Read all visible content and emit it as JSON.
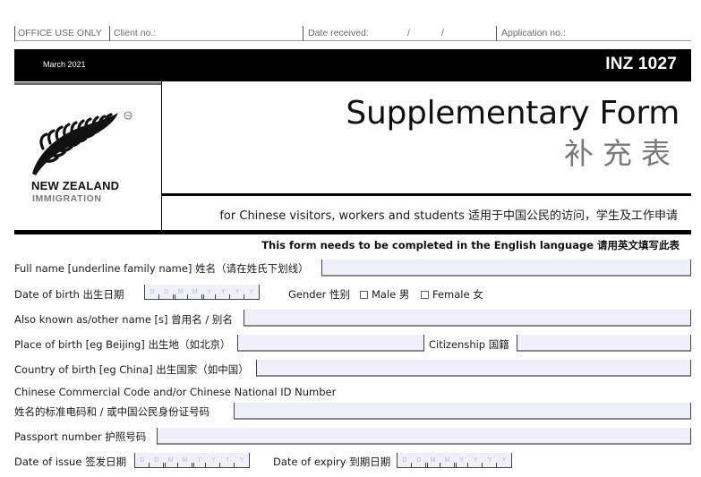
{
  "office_use": {
    "label": "OFFICE USE ONLY",
    "client_no": "Client no.:",
    "date_received": "Date received:",
    "date_sep1": "/",
    "date_sep2": "/",
    "application_no": "Application no.:"
  },
  "header": {
    "date": "March 2021",
    "form_number": "INZ 1027"
  },
  "logo": {
    "line1": "NEW ZEALAND",
    "line2": "IMMIGRATION",
    "icon": "silver-fern-icon",
    "trademark": "TM"
  },
  "title": {
    "english": "Supplementary Form",
    "chinese": "补充表",
    "subtitle": "for Chinese visitors, workers and students 适用于中国公民的访问，学生及工作申请"
  },
  "notice": "This form needs to be completed in the English language 请用英文填写此表",
  "date_placeholder": [
    "D",
    "D",
    "M",
    "M",
    "Y",
    "Y",
    "Y",
    "Y"
  ],
  "fields": {
    "full_name": {
      "label": "Full name [underline family name] 姓名（请在姓氏下划线）",
      "value": ""
    },
    "dob": {
      "label": "Date of birth 出生日期",
      "value": ""
    },
    "gender": {
      "label": "Gender 性别",
      "options": [
        {
          "label": "Male 男",
          "checked": false
        },
        {
          "label": "Female 女",
          "checked": false
        }
      ]
    },
    "aka": {
      "label": "Also known as/other name [s] 曾用名 / 别名",
      "value": ""
    },
    "place_of_birth": {
      "label": "Place of birth [eg Beijing] 出生地（如北京）",
      "value": ""
    },
    "citizenship": {
      "label": "Citizenship 国籍",
      "value": ""
    },
    "country_of_birth": {
      "label": "Country of birth [eg China] 出生国家（如中国）",
      "value": ""
    },
    "ccc_id": {
      "label_line1": "Chinese Commercial Code and/or Chinese National ID Number",
      "label_line2": "姓名的标准电码和 / 或中国公民身份证号码",
      "value": ""
    },
    "passport": {
      "label": "Passport number 护照号码",
      "value": ""
    },
    "date_of_issue": {
      "label": "Date of issue 签发日期",
      "value": ""
    },
    "date_of_expiry": {
      "label": "Date of expiry 到期日期",
      "value": ""
    }
  }
}
